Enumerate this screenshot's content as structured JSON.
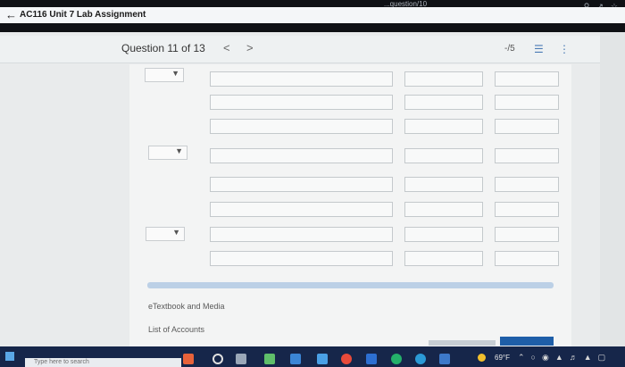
{
  "browser": {
    "url_fragment": "...question/10"
  },
  "header": {
    "back_symbol": "←",
    "app_title": "AC116 Unit 7 Lab Assignment"
  },
  "question_nav": {
    "label": "Question 11 of 13",
    "prev": "<",
    "next": ">",
    "score": "-/5"
  },
  "links": {
    "etextbook": "eTextbook and Media",
    "accounts": "List of Accounts"
  },
  "taskbar": {
    "search_placeholder": "Type here to search",
    "temperature": "69°F"
  },
  "colors": {
    "accent": "#1e5ea8",
    "scrollbar": "#bcd0e6",
    "taskbar": "#16264a"
  }
}
